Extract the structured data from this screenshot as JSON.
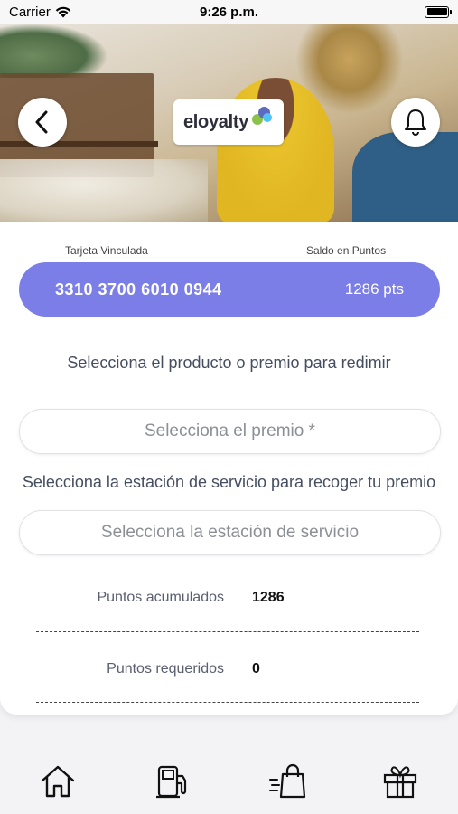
{
  "status_bar": {
    "carrier": "Carrier",
    "time": "9:26 p.m."
  },
  "header": {
    "logo_text": "eloyalty",
    "back_icon": "chevron-left-icon",
    "bell_icon": "bell-icon"
  },
  "card": {
    "linked_card_label": "Tarjeta Vinculada",
    "balance_label": "Saldo en Puntos",
    "card_number": "3310 3700 6010 0944",
    "points_balance": "1286 pts",
    "accent_color": "#7b7ee6"
  },
  "form": {
    "product_instruction": "Selecciona el producto o premio para redimir",
    "prize_placeholder": "Selecciona el premio *",
    "station_instruction": "Selecciona la estación de servicio para recoger tu premio",
    "station_placeholder": "Selecciona la estación de servicio"
  },
  "summary": {
    "accumulated_label": "Puntos acumulados",
    "accumulated_value": "1286",
    "required_label": "Puntos requeridos",
    "required_value": "0"
  },
  "bottom_nav": {
    "items": [
      {
        "icon": "home-icon"
      },
      {
        "icon": "fuel-pump-icon"
      },
      {
        "icon": "shopping-bag-icon"
      },
      {
        "icon": "gift-icon"
      }
    ]
  }
}
